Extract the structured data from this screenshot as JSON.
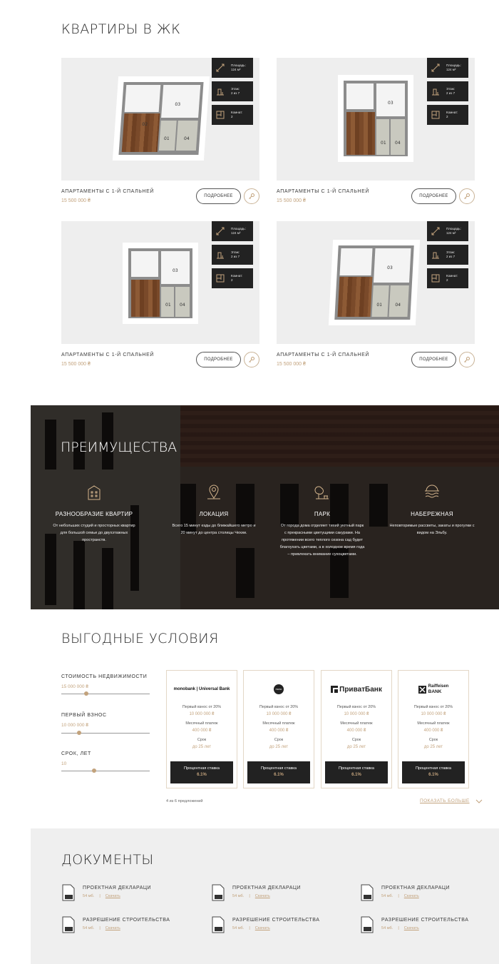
{
  "apartments": {
    "title": "КВАРТИРЫ В ЖК",
    "cards": [
      {
        "name": "АПАРТАМЕНТЫ С 1-Й СПАЛЬНЕЙ",
        "price": "15 500 000 ₴",
        "more": "ПОДРОБНЕЕ",
        "area_label": "Площадь:",
        "area_value": "124 м²",
        "floor_label": "Этаж:",
        "floor_value": "2 из 7",
        "rooms_label": "Комнат:",
        "rooms_value": "2"
      },
      {
        "name": "АПАРТАМЕНТЫ С 1-Й СПАЛЬНЕЙ",
        "price": "15 500 000 ₴",
        "more": "ПОДРОБНЕЕ",
        "area_label": "Площадь:",
        "area_value": "124 м²",
        "floor_label": "Этаж:",
        "floor_value": "2 из 7",
        "rooms_label": "Комнат:",
        "rooms_value": "2"
      },
      {
        "name": "АПАРТАМЕНТЫ С 1-Й СПАЛЬНЕЙ",
        "price": "15 500 000 ₴",
        "more": "ПОДРОБНЕЕ",
        "area_label": "Площадь:",
        "area_value": "124 м²",
        "floor_label": "Этаж:",
        "floor_value": "2 из 7",
        "rooms_label": "Комнат:",
        "rooms_value": "2"
      },
      {
        "name": "АПАРТАМЕНТЫ С 1-Й СПАЛЬНЕЙ",
        "price": "15 500 000 ₴",
        "more": "ПОДРОБНЕЕ",
        "area_label": "Площадь:",
        "area_value": "124 м²",
        "floor_label": "Этаж:",
        "floor_value": "2 из 7",
        "rooms_label": "Комнат:",
        "rooms_value": "2"
      }
    ],
    "room_labels": [
      "03",
      "02",
      "01",
      "04"
    ]
  },
  "advantages": {
    "title": "ПРЕИМУЩЕСТВА",
    "items": [
      {
        "title": "РАЗНООБРАЗИЕ КВАРТИР",
        "text": "От небольших студий и просторных квартир для большой семьи до двухэтажных пространств.",
        "icon": "building-icon"
      },
      {
        "title": "ЛОКАЦИЯ",
        "text": "Всего 15 минут езды до ближайшего метро и 20 минут до центра столицы Чехии.",
        "icon": "location-icon"
      },
      {
        "title": "ПАРК",
        "text": "От города дома отделяет тихий уютный парк с прекрасными цветущими сакурами. На протяжении всего теплого сезона сад будет благоухать цветами, а в холодное время года – привлекать внимание сухоцветами.",
        "icon": "park-icon"
      },
      {
        "title": "НАБЕРЕЖНАЯ",
        "text": "Неповторимые рассветы, закаты и прогулки с видом на Эльбу.",
        "icon": "embankment-icon"
      }
    ]
  },
  "conditions": {
    "title": "ВЫГОДНЫЕ УСЛОВИЯ",
    "sliders": [
      {
        "label": "СТОИМОСТЬ НЕДВИЖИМОСТИ",
        "value": "15 000 000 ₴"
      },
      {
        "label": "ПЕРВЫЙ ВЗНОС",
        "value": "10 000 000 ₴"
      },
      {
        "label": "СРОК, ЛЕТ",
        "value": "10"
      }
    ],
    "banks": [
      {
        "name": "monobank | Universal Bank",
        "down_label": "Первый взнос от 20%",
        "down_value": "10 000 000 ₴",
        "monthly_label": "Месячный платеж",
        "monthly_value": "400 000 ₴",
        "term_label": "Срок",
        "term_value": "до 25 лет",
        "rate_label": "Процентная ставка",
        "rate_value": "6.1%"
      },
      {
        "name": "mono",
        "down_label": "Первый взнос от 20%",
        "down_value": "10 000 000 ₴",
        "monthly_label": "Месячный платеж",
        "monthly_value": "400 000 ₴",
        "term_label": "Срок",
        "term_value": "до 25 лет",
        "rate_label": "Процентная ставка",
        "rate_value": "6.1%"
      },
      {
        "name": "ПриватБанк",
        "down_label": "Первый взнос от 20%",
        "down_value": "10 000 000 ₴",
        "monthly_label": "Месячный платеж",
        "monthly_value": "400 000 ₴",
        "term_label": "Срок",
        "term_value": "до 25 лет",
        "rate_label": "Процентная ставка",
        "rate_value": "6.1%"
      },
      {
        "name": "Raiffeisen BANK",
        "name_line1": "Raiffeisen",
        "name_line2": "BANK",
        "down_label": "Первый взнос от 20%",
        "down_value": "10 000 000 ₴",
        "monthly_label": "Месячный платеж",
        "monthly_value": "400 000 ₴",
        "term_label": "Срок",
        "term_value": "до 25 лет",
        "rate_label": "Процентная ставка",
        "rate_value": "6.1%"
      }
    ],
    "offers_count": "4 из 6 предложений",
    "show_more": "ПОКАЗАТЬ БОЛЬШЕ"
  },
  "documents": {
    "title": "ДОКУМЕНТЫ",
    "items": [
      {
        "name": "ПРОЕКТНАЯ ДЕКЛАРАЦИ",
        "size": "54 мб.",
        "link": "Скачать"
      },
      {
        "name": "ПРОЕКТНАЯ ДЕКЛАРАЦИ",
        "size": "54 мб.",
        "link": "Скачать"
      },
      {
        "name": "ПРОЕКТНАЯ ДЕКЛАРАЦИ",
        "size": "54 мб.",
        "link": "Скачать"
      },
      {
        "name": "РАЗРЕШЕНИЕ СТРОИТЕЛЬСТВА",
        "size": "54 мб.",
        "link": "Скачать"
      },
      {
        "name": "РАЗРЕШЕНИЕ СТРОИТЕЛЬСТВА",
        "size": "54 мб.",
        "link": "Скачать"
      },
      {
        "name": "РАЗРЕШЕНИЕ СТРОИТЕЛЬСТВА",
        "size": "54 мб.",
        "link": "Скачать"
      }
    ]
  },
  "colors": {
    "accent": "#c2a27c",
    "dark": "#222222",
    "panel": "#eeeeee"
  }
}
